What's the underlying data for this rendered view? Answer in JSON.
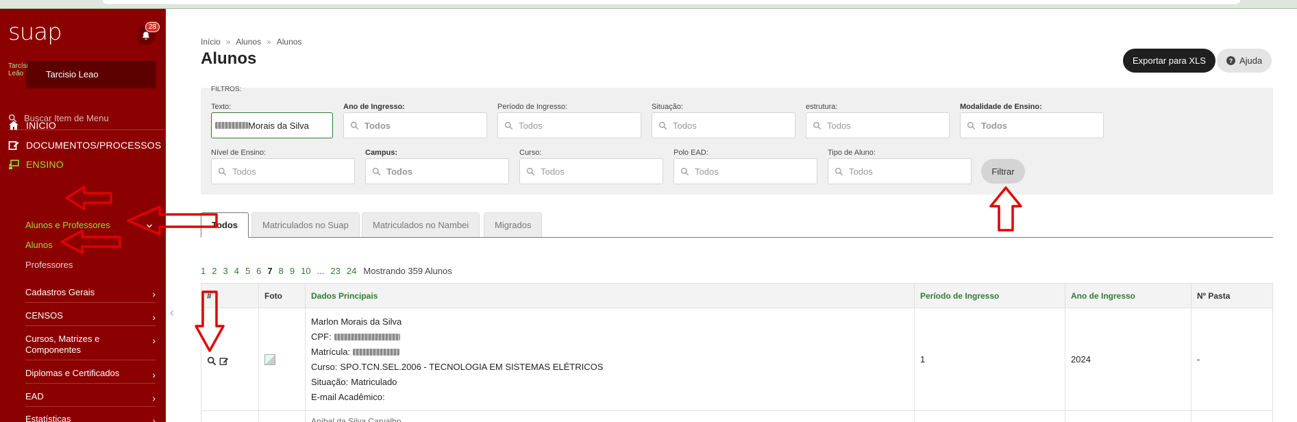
{
  "sidebar": {
    "logo": "suap",
    "notification_count": "28",
    "avatar_alt": "Tarcísio Leão",
    "user_name": "Tarcisio Leao",
    "search_placeholder": "Buscar Item de Menu",
    "nav": {
      "inicio": "INÍCIO",
      "documentos": "DOCUMENTOS/PROCESSOS",
      "ensino": "ENSINO"
    },
    "submenu": {
      "alunos_professores": "Alunos e Professores",
      "alunos": "Alunos",
      "professores": "Professores"
    },
    "categories": [
      "Cadastros Gerais",
      "CENSOS",
      "Cursos, Matrizes e Componentes",
      "Diplomas e Certificados",
      "EAD",
      "Estatísticas"
    ]
  },
  "breadcrumb": [
    "Início",
    "»",
    "Alunos",
    "»",
    "Alunos"
  ],
  "page_title": "Alunos",
  "actions": {
    "export_label": "Exportar para XLS",
    "help_label": "Ajuda"
  },
  "filters": {
    "title": "FILTROS:",
    "texto_label": "Texto:",
    "texto_value": "Morais da Silva",
    "ano_ingresso_label": "Ano de Ingresso:",
    "periodo_ingresso_label": "Período de Ingresso:",
    "situacao_label": "Situação:",
    "estrutura_label": "estrutura:",
    "modalidade_label": "Modalidade de Ensino:",
    "nivel_label": "Nível de Ensino:",
    "campus_label": "Campus:",
    "curso_label": "Curso:",
    "polo_label": "Polo EAD:",
    "tipo_label": "Tipo de Aluno:",
    "placeholder": "Todos",
    "filter_button": "Filtrar"
  },
  "tabs": [
    "Todos",
    "Matriculados no Suap",
    "Matriculados no Nambei",
    "Migrados"
  ],
  "pagination": {
    "pages": [
      "1",
      "2",
      "3",
      "4",
      "5",
      "6",
      "7",
      "8",
      "9",
      "10",
      "...",
      "23",
      "24"
    ],
    "current": "7",
    "summary": "Mostrando 359 Alunos"
  },
  "table": {
    "headers": [
      "#",
      "Foto",
      "Dados Principais",
      "Período de Ingresso",
      "Ano de Ingresso",
      "Nº Pasta"
    ],
    "rows": [
      {
        "name": "Marlon Morais da Silva",
        "cpf_label": "CPF:",
        "matricula_label": "Matrícula:",
        "curso_label": "Curso:",
        "curso_value": "SPO.TCN.SEL.2006 - TECNOLOGIA EM SISTEMAS ELÉTRICOS",
        "situacao_label": "Situação:",
        "situacao_value": "Matriculado",
        "email_label": "E-mail Acadêmico:",
        "periodo": "1",
        "ano": "2024",
        "pasta": "-"
      }
    ],
    "next_row_name_partial": "Aníbal da Silva Carvalho"
  },
  "colors": {
    "sidebar": "#8b0000",
    "accent_green": "#2e7d32",
    "annotation": "#e00000",
    "menu_active": "#9bdc3c"
  }
}
